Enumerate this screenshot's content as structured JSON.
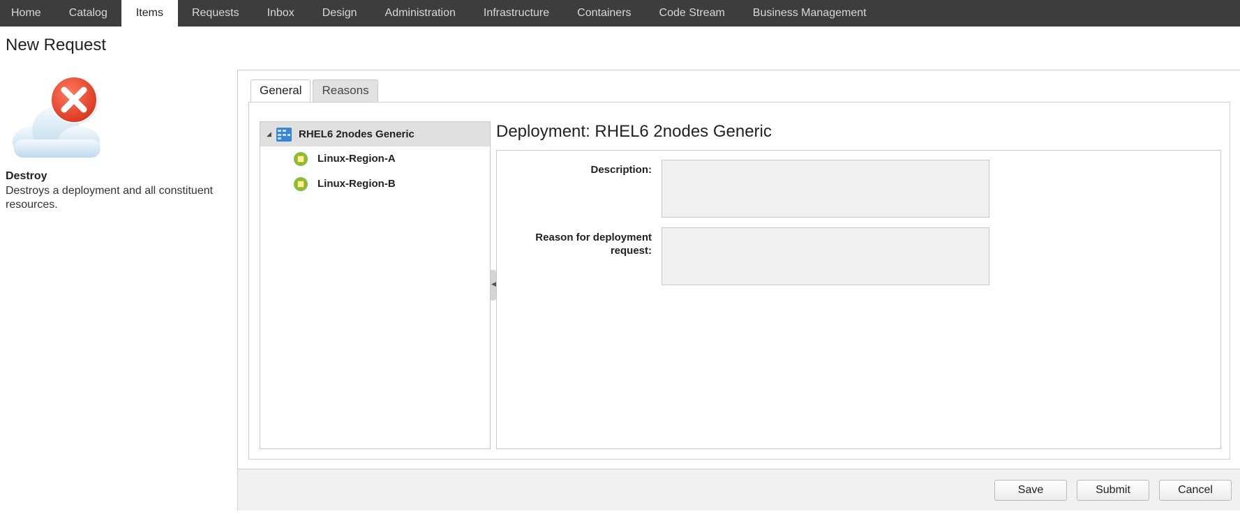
{
  "nav": {
    "tabs": [
      {
        "label": "Home"
      },
      {
        "label": "Catalog"
      },
      {
        "label": "Items"
      },
      {
        "label": "Requests"
      },
      {
        "label": "Inbox"
      },
      {
        "label": "Design"
      },
      {
        "label": "Administration"
      },
      {
        "label": "Infrastructure"
      },
      {
        "label": "Containers"
      },
      {
        "label": "Code Stream"
      },
      {
        "label": "Business Management"
      }
    ],
    "active_tab": "Items"
  },
  "page_title": "New Request",
  "catalog_item": {
    "icon": "cloud-destroy-icon",
    "name": "Destroy",
    "description": "Destroys a deployment and all constituent resources."
  },
  "form_tabs": [
    {
      "label": "General",
      "active": true
    },
    {
      "label": "Reasons",
      "active": false
    }
  ],
  "tree": {
    "root": {
      "label": "RHEL6 2nodes Generic",
      "icon": "deployment-icon",
      "expanded": true
    },
    "children": [
      {
        "label": "Linux-Region-A",
        "icon": "machine-icon"
      },
      {
        "label": "Linux-Region-B",
        "icon": "machine-icon"
      }
    ]
  },
  "detail": {
    "title": "Deployment: RHEL6 2nodes Generic",
    "fields": [
      {
        "label": "Description:",
        "value": ""
      },
      {
        "label": "Reason for deployment request:",
        "value": ""
      }
    ]
  },
  "footer": {
    "save_label": "Save",
    "submit_label": "Submit",
    "cancel_label": "Cancel"
  },
  "colors": {
    "nav_bg": "#3d3d3d",
    "accent_red": "#e0452f",
    "machine_green": "#7cc242"
  }
}
